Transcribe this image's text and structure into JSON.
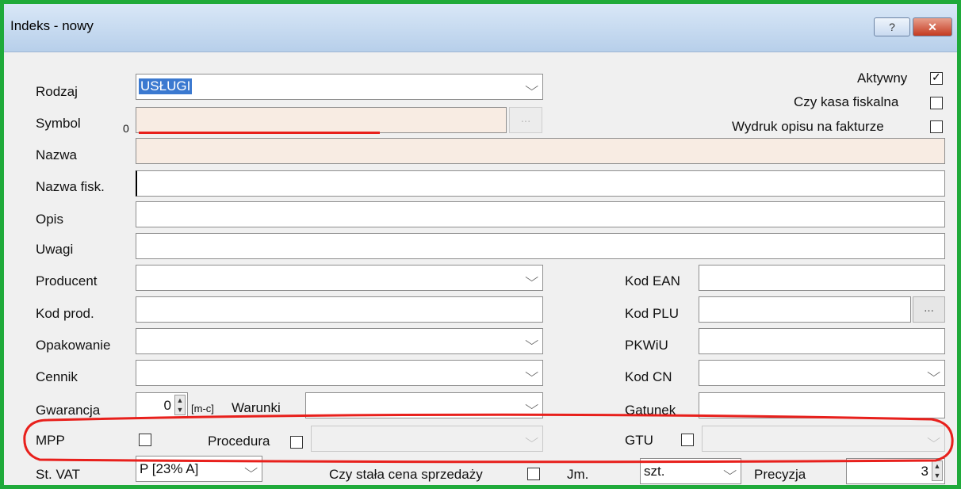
{
  "window": {
    "title": "Indeks - nowy",
    "help_label": "?",
    "close_label": "✕"
  },
  "form": {
    "rodzaj": {
      "label": "Rodzaj",
      "value": "USŁUGI"
    },
    "symbol": {
      "label": "Symbol",
      "counter": "0",
      "value": "",
      "browse_label": "..."
    },
    "nazwa": {
      "label": "Nazwa",
      "value": ""
    },
    "nazwa_fisk": {
      "label": "Nazwa fisk.",
      "value": ""
    },
    "opis": {
      "label": "Opis",
      "value": ""
    },
    "uwagi": {
      "label": "Uwagi",
      "value": ""
    },
    "producent": {
      "label": "Producent",
      "value": ""
    },
    "kod_prod": {
      "label": "Kod prod.",
      "value": ""
    },
    "opakowanie": {
      "label": "Opakowanie",
      "value": ""
    },
    "cennik": {
      "label": "Cennik",
      "value": ""
    },
    "gwarancja": {
      "label": "Gwarancja",
      "value": "0",
      "unit": "[m-c]"
    },
    "warunki": {
      "label": "Warunki",
      "value": ""
    },
    "mpp": {
      "label": "MPP",
      "checked": false
    },
    "procedura": {
      "label": "Procedura",
      "checked": false,
      "value": ""
    },
    "st_vat": {
      "label": "St. VAT",
      "value": "P [23% A]"
    },
    "stala_cena": {
      "label": "Czy stała cena sprzedaży",
      "checked": false
    },
    "jm": {
      "label": "Jm.",
      "value": "szt."
    },
    "precyzja": {
      "label": "Precyzja",
      "value": "3"
    },
    "aktywny": {
      "label": "Aktywny",
      "checked": true
    },
    "kasa_fiskalna": {
      "label": "Czy kasa fiskalna",
      "checked": false
    },
    "wydruk_opisu": {
      "label": "Wydruk opisu na fakturze",
      "checked": false
    },
    "kod_ean": {
      "label": "Kod EAN",
      "value": ""
    },
    "kod_plu": {
      "label": "Kod PLU",
      "value": "",
      "browse_label": "..."
    },
    "pkwiu": {
      "label": "PKWiU",
      "value": ""
    },
    "kod_cn": {
      "label": "Kod CN",
      "value": ""
    },
    "gatunek": {
      "label": "Gatunek",
      "value": ""
    },
    "gtu": {
      "label": "GTU",
      "checked": false,
      "value": ""
    }
  },
  "colors": {
    "frame_border": "#1faa3a",
    "annotation_red": "#e8201c",
    "required_field_bg": "#f8ece3",
    "selection_bg": "#3b79d0"
  },
  "icons": {
    "dropdown": "chevron-down-icon",
    "checkbox_checked": "checkmark-icon",
    "spinner": "spinner-arrows-icon"
  }
}
